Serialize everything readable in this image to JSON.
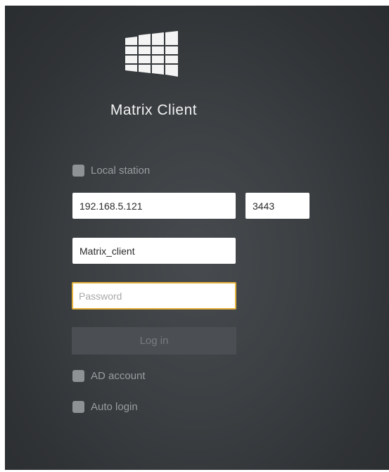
{
  "app": {
    "title": "Matrix Client",
    "logo_icon": "windows-grid-icon"
  },
  "form": {
    "local_station_label": "Local station",
    "local_station_checked": false,
    "server_address": "192.168.5.121",
    "server_port": "3443",
    "username": "Matrix_client",
    "password_value": "",
    "password_placeholder": "Password",
    "login_label": "Log in",
    "ad_account_label": "AD account",
    "ad_account_checked": false,
    "auto_login_label": "Auto login",
    "auto_login_checked": false
  },
  "colors": {
    "background": "#3a3e41",
    "focus_border": "#e3b23c",
    "checkbox": "#8f9295",
    "button": "#4b4e52"
  }
}
